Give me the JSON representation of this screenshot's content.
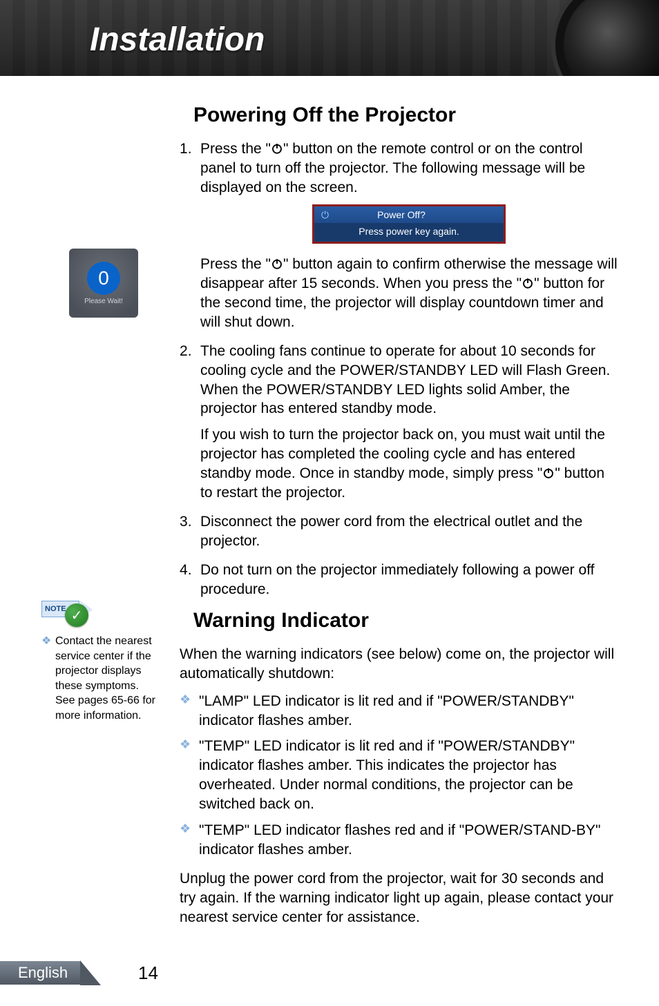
{
  "header": {
    "title": "Installation"
  },
  "section1": {
    "heading": "Powering Off the Projector",
    "step1_a": "Press the \"",
    "step1_b": "\" button on the remote control or on the control panel to turn off the projector. The following message will be displayed on the screen.",
    "osd_line1": "Power Off?",
    "osd_line2": "Press power key again.",
    "step1_c": "Press the \"",
    "step1_d": "\" button again to confirm otherwise the message will disappear after 15 seconds. When you press the \"",
    "step1_e": "\" button for the second time, the projector will display countdown timer and will shut down.",
    "step2_a": "The cooling fans continue to operate for about 10 seconds for cooling cycle and the POWER/STANDBY LED will Flash Green. When the POWER/STANDBY LED lights solid Amber, the projector has entered standby mode.",
    "step2_b1": "If you wish to turn the projector back on, you must wait until the projector has completed the cooling cycle and has entered standby mode. Once in standby mode, simply press \"",
    "step2_b2": "\" button to restart the projector.",
    "step3": "Disconnect the power cord from the electrical outlet and the projector.",
    "step4": "Do not turn on the projector immediately following a power off procedure."
  },
  "sidebar": {
    "countdown_value": "0",
    "please_wait": "Please Wait!",
    "note_label": "NOTE",
    "note_text": "Contact the nearest service center if the projector displays these symptoms. See pages 65-66 for more information."
  },
  "section2": {
    "heading": "Warning Indicator",
    "intro": "When the warning indicators (see below) come on, the projector will automatically shutdown:",
    "bullet1": "\"LAMP\" LED indicator is lit red and if \"POWER/STANDBY\" indicator flashes amber.",
    "bullet2": "\"TEMP\" LED indicator is lit red and if \"POWER/STANDBY\" indicator flashes amber. This indicates the projector has overheated. Under normal conditions, the projector can be switched back on.",
    "bullet3": "\"TEMP\" LED indicator flashes red and if \"POWER/STAND-BY\" indicator flashes amber.",
    "outro": "Unplug the power cord from the projector, wait for 30 seconds and try again. If the warning indicator light up again, please contact your nearest service center for assistance."
  },
  "footer": {
    "language": "English",
    "page": "14"
  }
}
